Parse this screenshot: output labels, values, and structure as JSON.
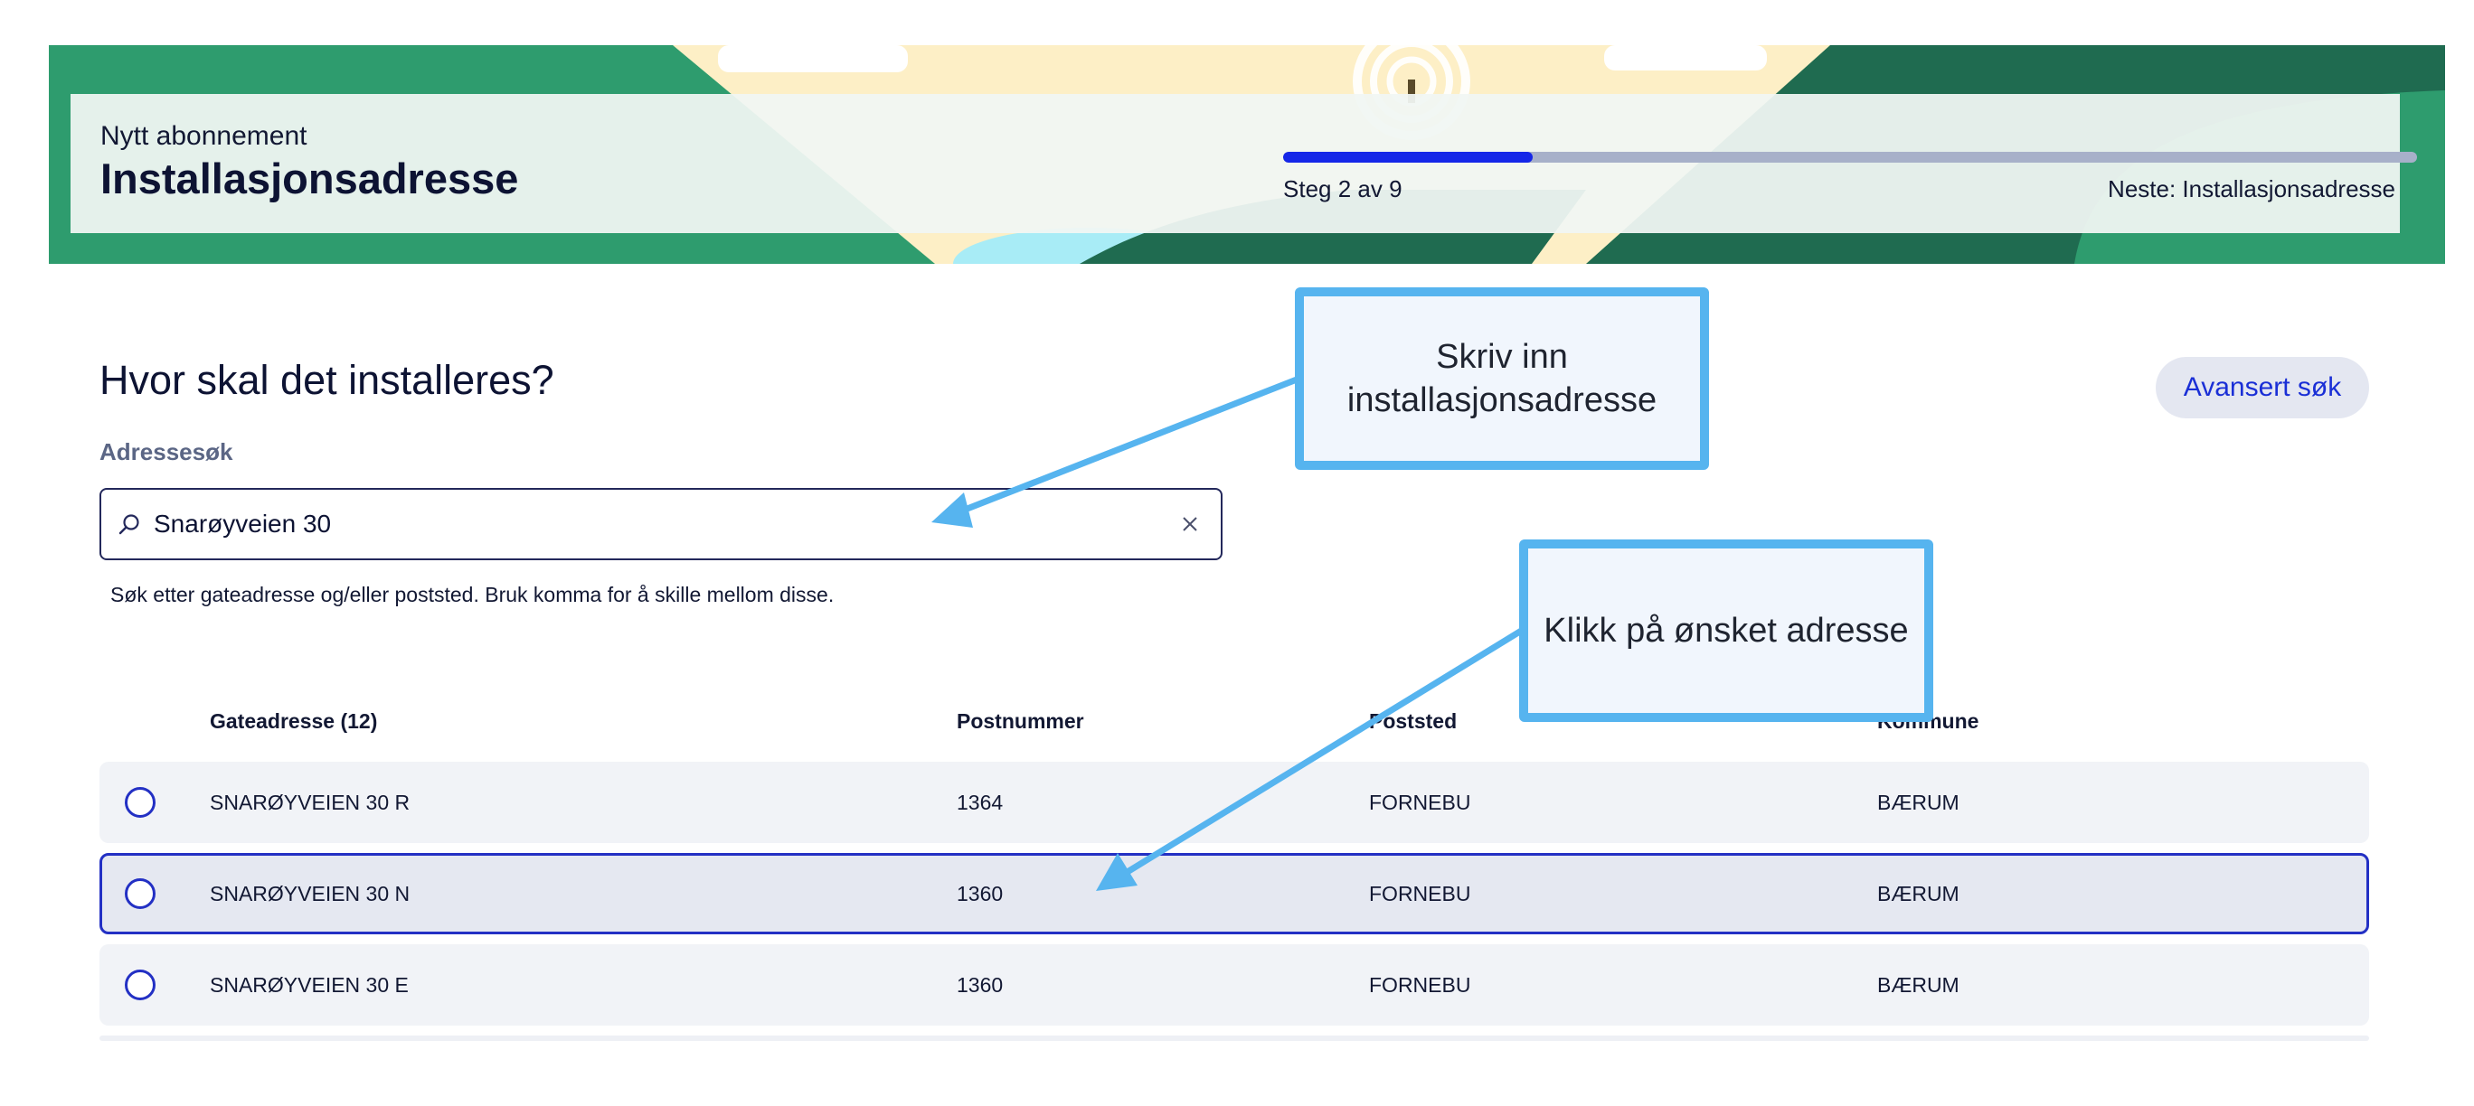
{
  "header": {
    "subtitle": "Nytt abonnement",
    "title": "Installasjonsadresse",
    "progress": {
      "current": 2,
      "total": 9,
      "fraction": 0.22
    },
    "step_text": "Steg 2 av 9",
    "next_text": "Neste: Installasjonsadresse"
  },
  "form": {
    "question": "Hvor skal det installeres?",
    "advanced_search_label": "Avansert søk",
    "search_label": "Adressesøk",
    "search_value": "Snarøyveien 30",
    "search_hint": "Søk etter gateadresse og/eller poststed. Bruk komma for å skille mellom disse."
  },
  "table": {
    "columns": [
      "Gateadresse (12)",
      "Postnummer",
      "Poststed",
      "Kommune"
    ],
    "rows": [
      {
        "gateadresse": "SNARØYVEIEN 30 R",
        "postnummer": "1364",
        "poststed": "FORNEBU",
        "kommune": "BÆRUM",
        "selected": false
      },
      {
        "gateadresse": "SNARØYVEIEN 30 N",
        "postnummer": "1360",
        "poststed": "FORNEBU",
        "kommune": "BÆRUM",
        "selected": true
      },
      {
        "gateadresse": "SNARØYVEIEN 30 E",
        "postnummer": "1360",
        "poststed": "FORNEBU",
        "kommune": "BÆRUM",
        "selected": false
      }
    ]
  },
  "callouts": {
    "first": "Skriv inn installasjonsadresse",
    "second": "Klikk på ønsket adresse"
  },
  "colors": {
    "brand_green": "#2e9c6e",
    "dark_green": "#1f6b50",
    "accent_blue": "#1526e8",
    "callout_border": "#56b4ef"
  },
  "icons": {
    "search": "search-icon",
    "clear": "close-icon",
    "radio": "radio-unchecked-icon"
  }
}
